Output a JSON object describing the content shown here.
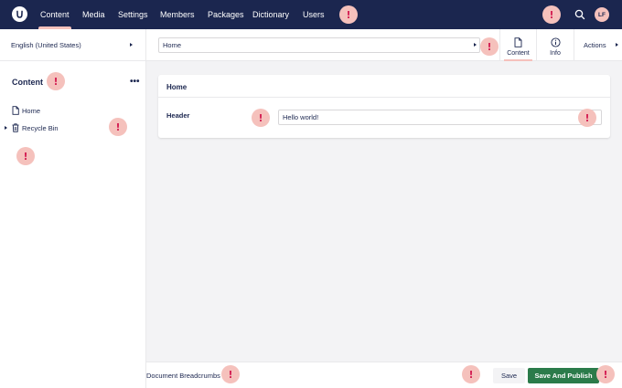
{
  "nav": {
    "items": [
      {
        "label": "Content",
        "active": true
      },
      {
        "label": "Media"
      },
      {
        "label": "Settings"
      },
      {
        "label": "Members"
      },
      {
        "label": "Packages"
      },
      {
        "label": "Dictionary"
      },
      {
        "label": "Users"
      }
    ],
    "search_icon": "search-icon",
    "user_initials": "LF"
  },
  "sidebar": {
    "culture": "English (United States)",
    "section_title": "Content",
    "more_label": "•••",
    "tree": [
      {
        "label": "Home",
        "icon": "document-icon"
      },
      {
        "label": "Recycle Bin",
        "icon": "trash-icon"
      }
    ]
  },
  "editor": {
    "name_value": "Home",
    "views": [
      {
        "label": "Content",
        "icon": "document-icon",
        "active": true
      },
      {
        "label": "Info",
        "icon": "info-icon"
      }
    ],
    "actions_label": "Actions",
    "group_title": "Home",
    "property_label": "Header",
    "property_value": "Hello world!"
  },
  "footer": {
    "breadcrumbs": "Document Breadcrumbs",
    "save_label": "Save",
    "publish_label": "Save And Publish"
  },
  "warnings": {
    "symbol": "!"
  },
  "colors": {
    "header": "#1b264f",
    "accent": "#f5c1bc",
    "warning": "#d42054",
    "publish": "#2b7b4a"
  }
}
